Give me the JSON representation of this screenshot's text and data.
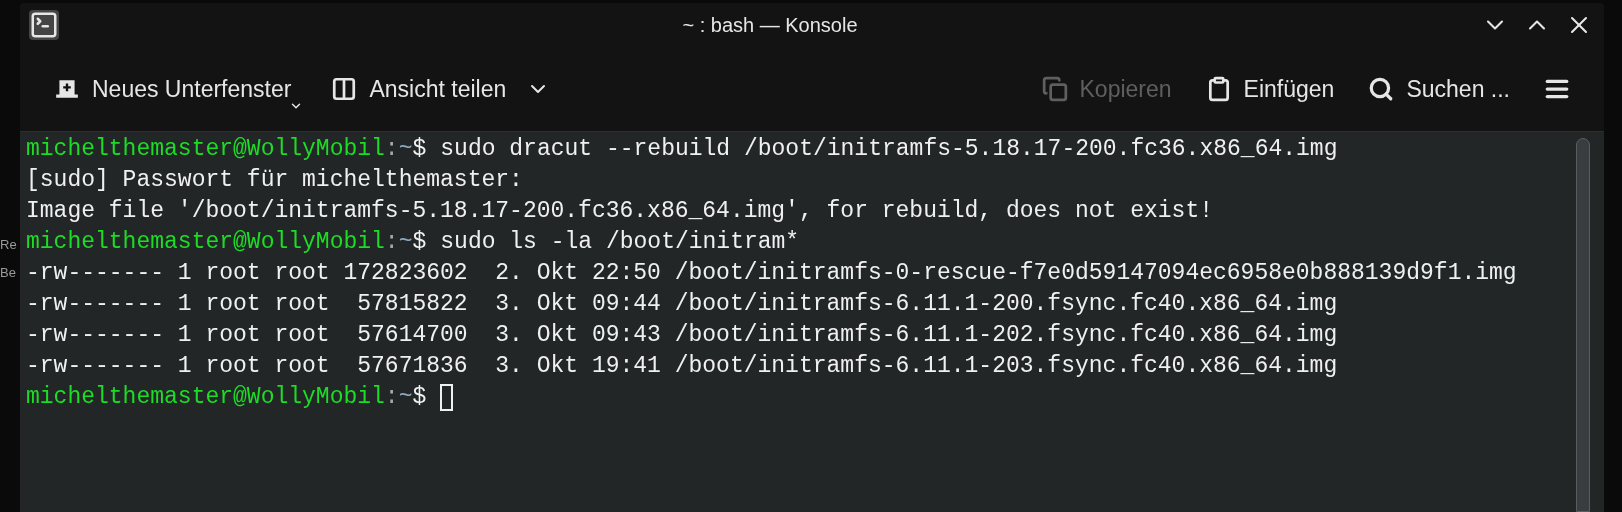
{
  "background_fragments": [
    "Re",
    "Be"
  ],
  "window": {
    "title": "~ : bash — Konsole"
  },
  "toolbar": [
    {
      "kind": "new-tab",
      "label": "Neues Unterfenster",
      "dropdown": true,
      "disabled": false
    },
    {
      "kind": "split",
      "label": "Ansicht teilen",
      "dropdown": true,
      "disabled": false
    },
    {
      "kind": "copy",
      "label": "Kopieren",
      "disabled": true
    },
    {
      "kind": "paste",
      "label": "Einfügen",
      "disabled": false
    },
    {
      "kind": "search",
      "label": "Suchen ...",
      "disabled": false
    },
    {
      "kind": "hamburger",
      "disabled": false
    }
  ],
  "terminal": {
    "lines": [
      {
        "kind": "prompt",
        "user_host": "michelthemaster@WollyMobil",
        "separator": ":",
        "path": "~",
        "symbol": "$",
        "command": "sudo dracut --rebuild /boot/initramfs-5.18.17-200.fc36.x86_64.img"
      },
      {
        "kind": "output",
        "text": "[sudo] Passwort für michelthemaster:"
      },
      {
        "kind": "output",
        "text": "Image file '/boot/initramfs-5.18.17-200.fc36.x86_64.img', for rebuild, does not exist!"
      },
      {
        "kind": "prompt",
        "user_host": "michelthemaster@WollyMobil",
        "separator": ":",
        "path": "~",
        "symbol": "$",
        "command": "sudo ls -la /boot/initram*"
      },
      {
        "kind": "output",
        "text": "-rw------- 1 root root 172823602  2. Okt 22:50 /boot/initramfs-0-rescue-f7e0d59147094ec6958e0b888139d9f1.img"
      },
      {
        "kind": "output",
        "text": "-rw------- 1 root root  57815822  3. Okt 09:44 /boot/initramfs-6.11.1-200.fsync.fc40.x86_64.img"
      },
      {
        "kind": "output",
        "text": "-rw------- 1 root root  57614700  3. Okt 09:43 /boot/initramfs-6.11.1-202.fsync.fc40.x86_64.img"
      },
      {
        "kind": "output",
        "text": "-rw------- 1 root root  57671836  3. Okt 19:41 /boot/initramfs-6.11.1-203.fsync.fc40.x86_64.img"
      },
      {
        "kind": "prompt",
        "user_host": "michelthemaster@WollyMobil",
        "separator": ":",
        "path": "~",
        "symbol": "$",
        "cursor": true
      }
    ]
  }
}
